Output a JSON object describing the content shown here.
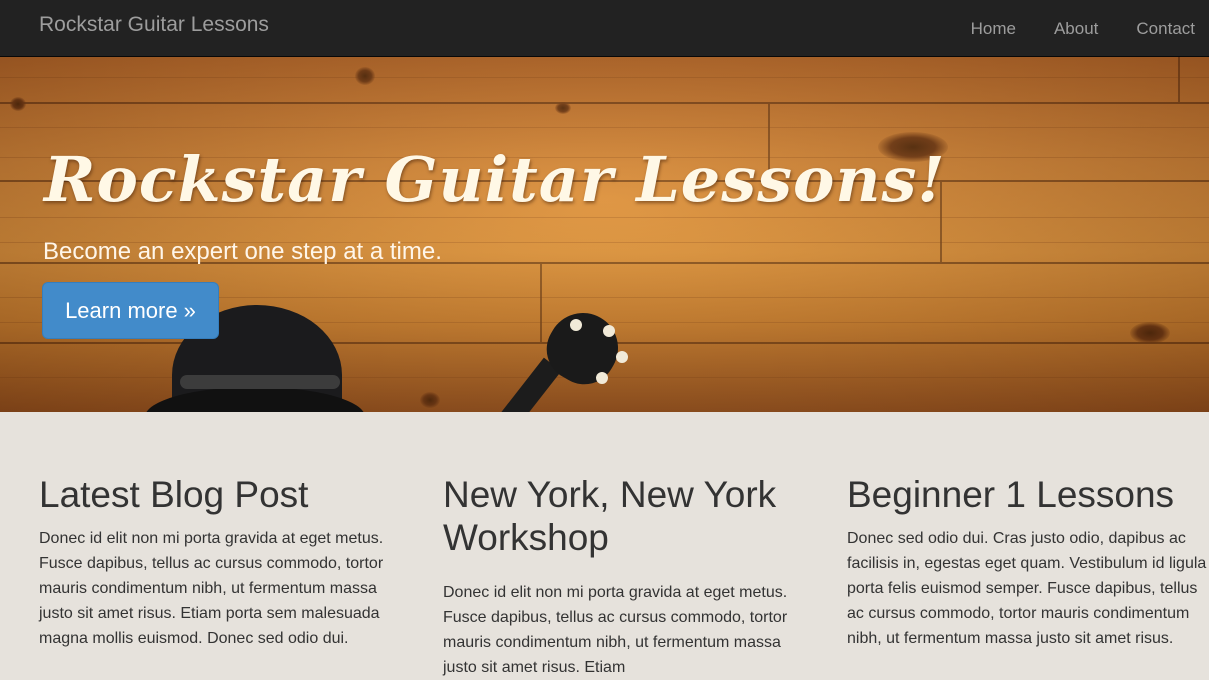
{
  "navbar": {
    "brand": "Rockstar Guitar Lessons",
    "links": [
      "Home",
      "About",
      "Contact"
    ]
  },
  "hero": {
    "title": "Rockstar Guitar Lessons!",
    "subtitle": "Become an expert one step at a time.",
    "button_label": "Learn more »"
  },
  "columns": [
    {
      "heading": "Latest Blog Post",
      "body": "Donec id elit non mi porta gravida at eget metus. Fusce dapibus, tellus ac cursus commodo, tortor mauris condimentum nibh, ut fermentum massa justo sit amet risus. Etiam porta sem malesuada magna mollis euismod. Donec sed odio dui."
    },
    {
      "heading": "New York, New York Workshop",
      "body": "Donec id elit non mi porta gravida at eget metus. Fusce dapibus, tellus ac cursus commodo, tortor mauris condimentum nibh, ut fermentum massa justo sit amet risus. Etiam"
    },
    {
      "heading": "Beginner 1 Lessons",
      "body": "Donec sed odio dui. Cras justo odio, dapibus ac facilisis in, egestas eget quam. Vestibulum id ligula porta felis euismod semper. Fusce dapibus, tellus ac cursus commodo, tortor mauris condimentum nibh, ut fermentum massa justo sit amet risus."
    }
  ],
  "colors": {
    "navbar_bg": "#222222",
    "nav_text": "#9d9d9d",
    "button_bg": "#428bca",
    "page_bg": "#e6e2dc"
  }
}
